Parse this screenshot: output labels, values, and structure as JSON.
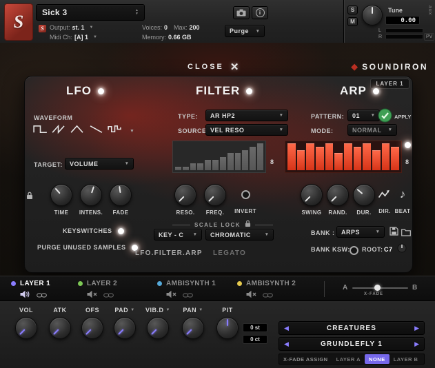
{
  "icons": {
    "dropdown_arrow": "▼",
    "expand": "▲",
    "collapse": "▼",
    "close_x": "✕",
    "check": "✓",
    "note": "♪",
    "left_arrow": "◀",
    "right_arrow": "▶",
    "diamond": "◆",
    "info": "i"
  },
  "header": {
    "logo_letter": "S",
    "title": "Sick 3",
    "output_label": "Output:",
    "output_value": "st. 1",
    "midi_label": "Midi Ch:",
    "midi_value": "[A] 1",
    "voices_label": "Voices:",
    "voices_value": "0",
    "max_label": "Max:",
    "max_value": "200",
    "memory_label": "Memory:",
    "memory_value": "0.66 GB",
    "purge_label": "Purge",
    "solo_label": "S",
    "mute_label": "M",
    "tune_label": "Tune",
    "tune_value": "0.00",
    "aux_label": "aux",
    "pv_label": "PV",
    "left_label": "L",
    "right_label": "R"
  },
  "overlay": {
    "close_label": "CLOSE",
    "brand": "SOUNDIRON",
    "layer_badge": "LAYER 1"
  },
  "lfo": {
    "title": "LFO",
    "waveform_label": "WAVEFORM",
    "waveforms": [
      "square",
      "saw",
      "triangle",
      "ramp",
      "random"
    ],
    "target_label": "TARGET:",
    "target_value": "VOLUME",
    "knob_labels": [
      "TIME",
      "INTENS.",
      "FADE"
    ],
    "keyswitches_label": "KEYSWITCHES",
    "purge_label": "PURGE UNUSED SAMPLES"
  },
  "filter": {
    "title": "FILTER",
    "type_label": "TYPE:",
    "type_value": "AR HP2",
    "source_label": "SOURCE:",
    "source_value": "VEL RESO",
    "steps": [
      1,
      1,
      2,
      2,
      3,
      3,
      4,
      5,
      5,
      6,
      7,
      8
    ],
    "steps_max": 8,
    "rows_label": "8",
    "knob_labels": [
      "RESO.",
      "FREQ.",
      "INVERT"
    ],
    "scale_lock_label": "SCALE LOCK",
    "key_value": "KEY - C",
    "scale_value": "CHROMATIC",
    "footer_left": "LFO.FILTER.ARP",
    "footer_right": "LEGATO"
  },
  "arp": {
    "title": "ARP",
    "pattern_label": "PATTERN:",
    "pattern_value": "01",
    "mode_label": "MODE:",
    "mode_value": "NORMAL",
    "apply_label": "APPLY",
    "steps": [
      8,
      6,
      8,
      7,
      8,
      5,
      8,
      7,
      8,
      6,
      8,
      7
    ],
    "steps_max": 8,
    "rows_label": "8",
    "knob_labels": [
      "SWING",
      "RAND.",
      "DUR.",
      "DIR.",
      "BEAT"
    ],
    "bank_label": "BANK :",
    "bank_value": "ARPS",
    "bank_ksw_label": "BANK KSW:",
    "root_label": "ROOT:",
    "root_value": "C7"
  },
  "layers_bar": {
    "items": [
      {
        "label": "LAYER 1",
        "dot_color": "#8a7dff",
        "muted": false
      },
      {
        "label": "LAYER 2",
        "dot_color": "#7dc855",
        "muted": true
      },
      {
        "label": "AMBISYNTH 1",
        "dot_color": "#55a9d9",
        "muted": true
      },
      {
        "label": "AMBISYNTH 2",
        "dot_color": "#e5c94e",
        "muted": true
      }
    ],
    "xfade_a": "A",
    "xfade_b": "B",
    "xfade_label": "X-FADE"
  },
  "bottom": {
    "knobs": [
      {
        "label": "VOL",
        "dropdown": false
      },
      {
        "label": "ATK",
        "dropdown": false
      },
      {
        "label": "OFS",
        "dropdown": false
      },
      {
        "label": "PAD",
        "dropdown": true
      },
      {
        "label": "VIB.D",
        "dropdown": true
      },
      {
        "label": "PAN",
        "dropdown": true
      },
      {
        "label": "PIT",
        "dropdown": false
      }
    ],
    "pitch_semi": "0 st",
    "pitch_cents": "0 ct",
    "selector_top": "CREATURES",
    "selector_bottom": "GRUNDLEFLY 1",
    "xfade_assign_label": "X-FADE ASSIGN",
    "xfade_options": [
      "LAYER A",
      "NONE",
      "LAYER B"
    ],
    "xfade_selected": "NONE"
  },
  "colors": {
    "accent_purple": "#8a7dff",
    "arp_red": "#e8432c",
    "apply_green": "#3f9f55",
    "panel_glow_red": "#c8231a"
  }
}
